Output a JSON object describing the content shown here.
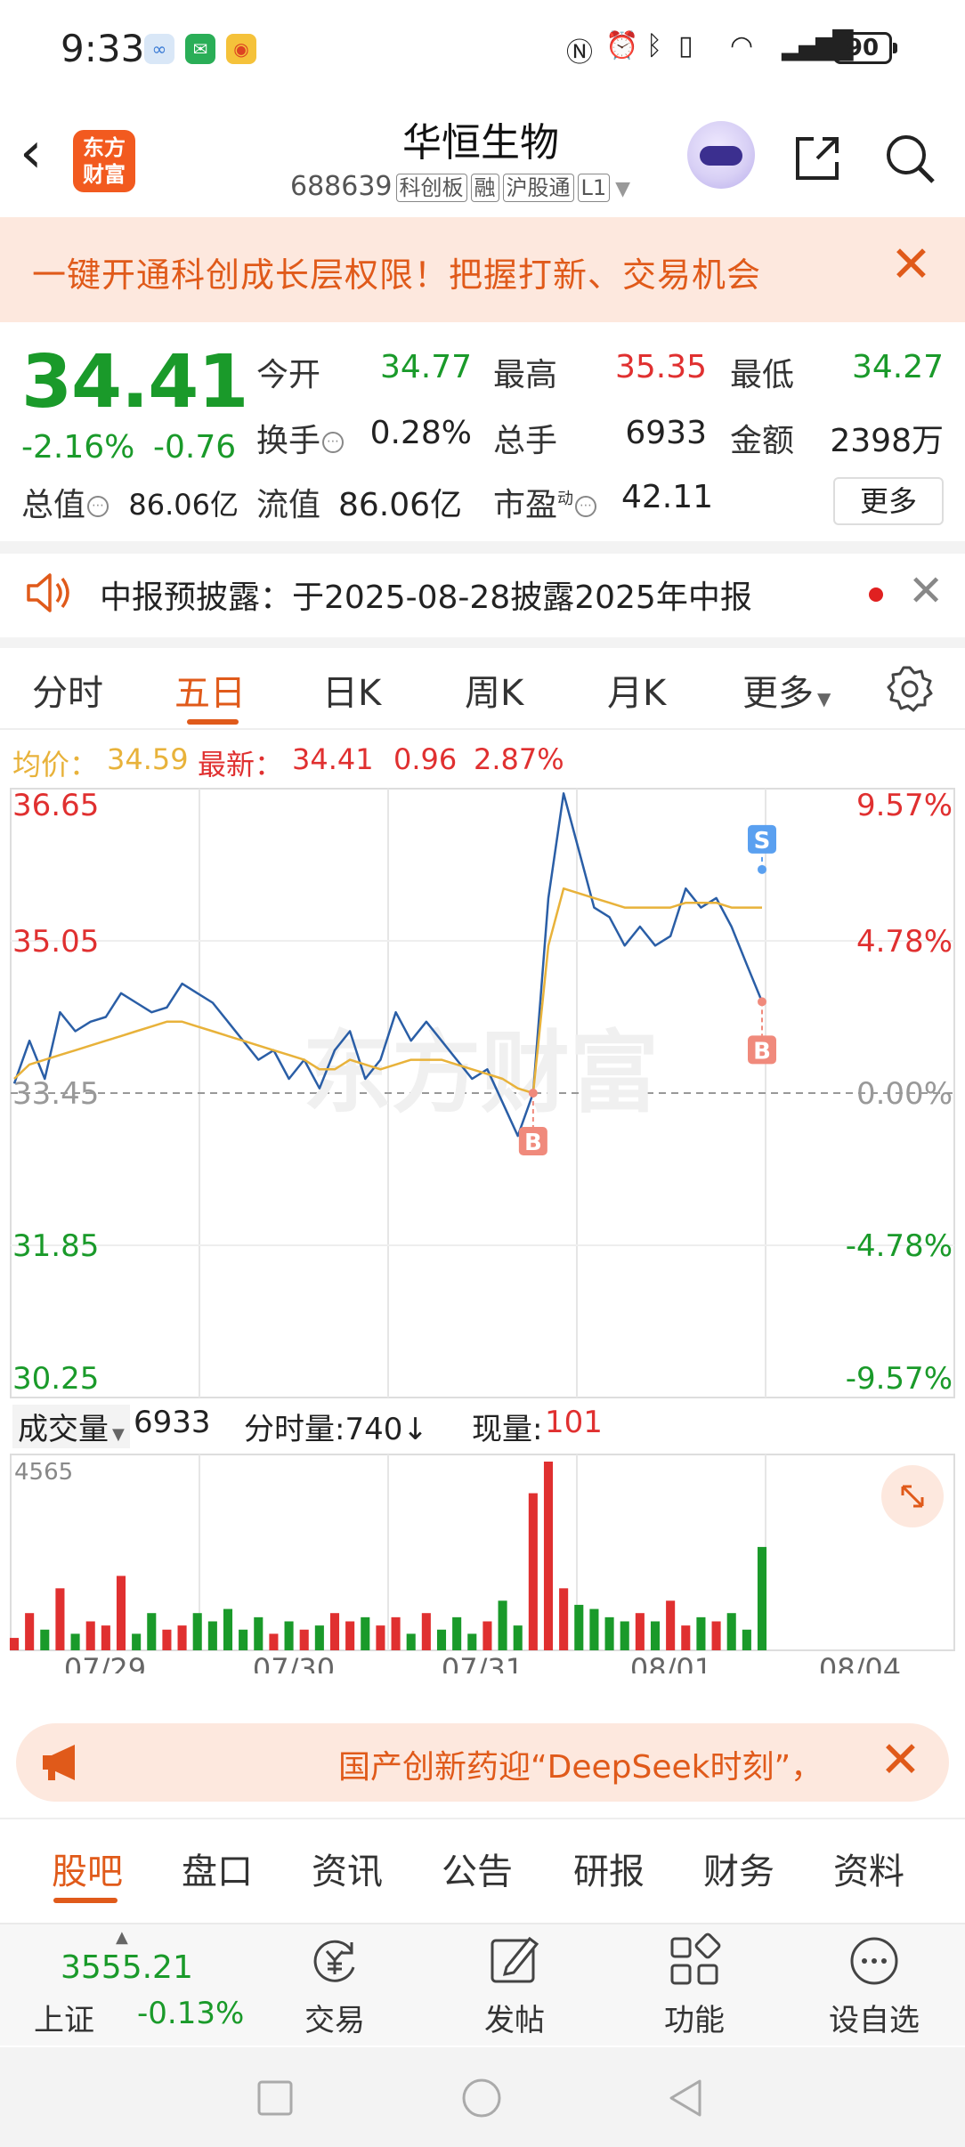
{
  "status_bar": {
    "time": "9:33",
    "battery": "90"
  },
  "header": {
    "logo_line1": "东方",
    "logo_line2": "财富",
    "stock_name": "华恒生物",
    "stock_code": "688639",
    "board": "科创板",
    "tags": [
      "融",
      "沪股通",
      "L1"
    ]
  },
  "banner": {
    "text": "一键开通科创成长层权限！把握打新、交易机会"
  },
  "quote": {
    "price": "34.41",
    "change_pct": "-2.16%",
    "change": "-0.76",
    "fields": [
      {
        "label": "今开",
        "value": "34.77",
        "color": "#1a9a2a"
      },
      {
        "label": "最高",
        "value": "35.35",
        "color": "#e03030"
      },
      {
        "label": "最低",
        "value": "34.27",
        "color": "#1a9a2a"
      },
      {
        "label": "换手",
        "value": "0.28%",
        "color": "#222222"
      },
      {
        "label": "总手",
        "value": "6933",
        "color": "#222222"
      },
      {
        "label": "金额",
        "value": "2398万",
        "color": "#222222"
      }
    ],
    "total_value_label": "总值",
    "total_value": "86.06亿",
    "float_value_label": "流值",
    "float_value": "86.06亿",
    "pe_label": "市盈",
    "pe_sup": "动",
    "pe_value": "42.11",
    "more": "更多"
  },
  "notice": {
    "text": "中报预披露：于2025-08-28披露2025年中报"
  },
  "chart_tabs": {
    "items": [
      "分时",
      "五日",
      "日K",
      "周K",
      "月K",
      "更多"
    ],
    "active": "五日"
  },
  "chart_header": {
    "avg_label": "均价：",
    "avg_value": "34.59",
    "latest_label": "最新：",
    "latest_value": "34.41",
    "latest_change": "0.96",
    "latest_pct": "2.87%"
  },
  "volume_header": {
    "select_label": "成交量",
    "volume": "6933",
    "minute_label": "分时量:740",
    "minute_arrow": "↓",
    "current_label": "现量:",
    "current_value": "101"
  },
  "chart_data": {
    "type": "line",
    "x_labels": [
      "07/29",
      "07/30",
      "07/31",
      "08/01",
      "08/04"
    ],
    "y_ticks_left": [
      "36.65",
      "35.05",
      "33.45",
      "31.85",
      "30.25"
    ],
    "y_ticks_right": [
      "9.57%",
      "4.78%",
      "0.00%",
      "-4.78%",
      "-9.57%"
    ],
    "ylim": [
      30.25,
      36.65
    ],
    "base_price": 33.45,
    "watermark": "东方财富",
    "series": [
      {
        "values": [
          33.55,
          34.0,
          33.6,
          34.3,
          34.1,
          34.2,
          34.25,
          34.5,
          34.4,
          34.3,
          34.35,
          34.6,
          34.5,
          34.4,
          34.2,
          34.0,
          33.8,
          33.9,
          33.6,
          33.8,
          33.5,
          33.9,
          34.1,
          33.6,
          33.8,
          34.3,
          34.0,
          34.2,
          34.0,
          33.8,
          33.6,
          33.7,
          33.35,
          33.0,
          33.45,
          35.5,
          36.6,
          36.0,
          35.4,
          35.3,
          35.0,
          35.2,
          35.0,
          35.1,
          35.6,
          35.4,
          35.5,
          35.2,
          34.8,
          34.41
        ],
        "color": "#2a5ea6"
      },
      {
        "values": [
          33.6,
          33.75,
          33.8,
          33.85,
          33.9,
          33.95,
          34.0,
          34.05,
          34.1,
          34.15,
          34.2,
          34.2,
          34.15,
          34.1,
          34.05,
          34.0,
          33.95,
          33.9,
          33.85,
          33.8,
          33.7,
          33.7,
          33.8,
          33.75,
          33.7,
          33.75,
          33.8,
          33.8,
          33.8,
          33.75,
          33.7,
          33.65,
          33.6,
          33.5,
          33.45,
          35.0,
          35.6,
          35.55,
          35.5,
          35.45,
          35.4,
          35.4,
          35.4,
          35.4,
          35.45,
          35.45,
          35.45,
          35.4,
          35.4,
          35.4
        ],
        "color": "#e8b23a"
      }
    ],
    "volume_max_label": "4565",
    "volume": [
      300,
      900,
      500,
      1500,
      400,
      700,
      600,
      1800,
      400,
      900,
      500,
      600,
      900,
      700,
      1000,
      500,
      800,
      400,
      700,
      500,
      600,
      900,
      700,
      800,
      600,
      800,
      400,
      900,
      500,
      800,
      400,
      700,
      1200,
      600,
      3800,
      4565,
      1500,
      1100,
      1000,
      800,
      700,
      900,
      700,
      1200,
      600,
      800,
      700,
      900,
      500,
      2500
    ],
    "markers": [
      {
        "label": "B",
        "x_index": 34,
        "price": 33.45,
        "color": "#f08a7c"
      },
      {
        "label": "S",
        "x_index": 49,
        "price": 35.8,
        "color": "#5aa0f0"
      },
      {
        "label": "B",
        "x_index": 49,
        "price": 34.41,
        "color": "#f08a7c"
      }
    ]
  },
  "news": {
    "text": "国产创新药迎“DeepSeek时刻”，"
  },
  "sub_tabs": {
    "items": [
      "股吧",
      "盘口",
      "资讯",
      "公告",
      "研报",
      "财务",
      "资料"
    ],
    "active": "股吧"
  },
  "bottom_bar": {
    "index_value": "3555.21",
    "index_name": "上证",
    "index_change": "-0.13%",
    "items": [
      {
        "label": "交易",
        "icon": "trade-icon"
      },
      {
        "label": "发帖",
        "icon": "post-icon"
      },
      {
        "label": "功能",
        "icon": "function-icon"
      },
      {
        "label": "设自选",
        "icon": "add-favorite-icon"
      }
    ]
  }
}
